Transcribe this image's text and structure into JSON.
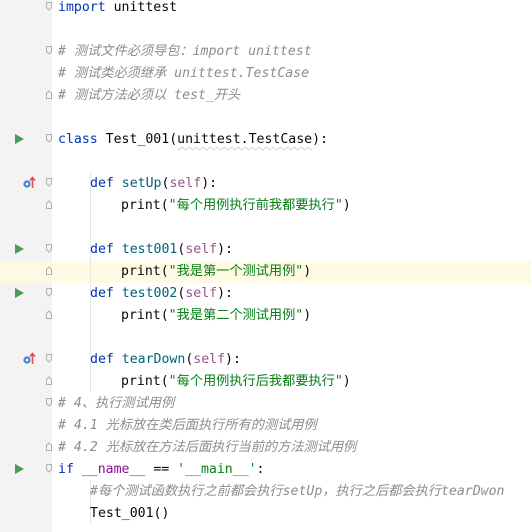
{
  "editor": {
    "language": "python",
    "colors": {
      "keyword": "#0033b3",
      "function": "#00627a",
      "self": "#94558d",
      "string": "#067d17",
      "comment": "#8c8c8c",
      "dunder": "#871094",
      "highlight_line": "#fffae3",
      "run_icon": "#499c54",
      "gutter": "#f3f3f3"
    },
    "lines": {
      "l01": {
        "kw": "import",
        "rest": " unittest"
      },
      "l03": {
        "cmt": "# 测试文件必须导包：import unittest"
      },
      "l04": {
        "cmt": "# 测试类必须继承 unittest.TestCase"
      },
      "l05": {
        "cmt": "# 测试方法必须以 test_开头"
      },
      "l07": {
        "kw": "class",
        "name": "Test_001",
        "p1": "(",
        "base": "unittest.TestCase",
        "p2": "):"
      },
      "l09": {
        "kw": "def",
        "name": "setUp",
        "p1": "(",
        "self": "self",
        "p2": "):"
      },
      "l10": {
        "call": "print",
        "p1": "(",
        "str": "\"每个用例执行前我都要执行\"",
        "p2": ")"
      },
      "l12": {
        "kw": "def",
        "name": "test001",
        "p1": "(",
        "self": "self",
        "p2": "):"
      },
      "l13": {
        "call": "print",
        "p1": "(",
        "str": "\"我是第一个测试用例\"",
        "p2": ")"
      },
      "l14": {
        "kw": "def",
        "name": "test002",
        "p1": "(",
        "self": "self",
        "p2": "):"
      },
      "l15": {
        "call": "print",
        "p1": "(",
        "str": "\"我是第二个测试用例\"",
        "p2": ")"
      },
      "l17": {
        "kw": "def",
        "name": "tearDown",
        "p1": "(",
        "self": "self",
        "p2": "):"
      },
      "l18": {
        "call": "print",
        "p1": "(",
        "str": "\"每个用例执行后我都要执行\"",
        "p2": ")"
      },
      "l19": {
        "cmt": "# 4、执行测试用例"
      },
      "l20": {
        "cmt": "# 4.1 光标放在类后面执行所有的测试用例"
      },
      "l21": {
        "cmt": "# 4.2 光标放在方法后面执行当前的方法测试用例"
      },
      "l22": {
        "kw": "if",
        "sp": " ",
        "dn": "__name__",
        "op": " == ",
        "str": "'__main__'",
        "colon": ":"
      },
      "l23": {
        "cmt": "#每个测试函数执行之前都会执行setUp，执行之后都会执行tearDwon"
      },
      "l24": {
        "call": "Test_001",
        "rest": "()"
      }
    },
    "gutter_icons": {
      "run": "run-test-icon",
      "override": "override-method-icon",
      "fold": "fold-marker-icon"
    }
  }
}
